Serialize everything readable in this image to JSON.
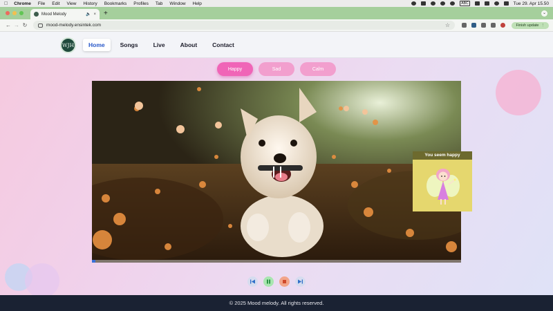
{
  "menubar": {
    "app": "Chrome",
    "items": [
      "File",
      "Edit",
      "View",
      "History",
      "Bookmarks",
      "Profiles",
      "Tab",
      "Window",
      "Help"
    ],
    "input_source": "ABC",
    "clock": "Tue 29. Apr  15.50"
  },
  "browser": {
    "tab_title": "Mood Melody",
    "url": "mood-melody.ensintek.com",
    "finish_update": "Finish update"
  },
  "site": {
    "logo_text": "WJH",
    "nav": [
      "Home",
      "Songs",
      "Live",
      "About",
      "Contact"
    ],
    "active_nav": "Home",
    "moods": [
      "Happy",
      "Sad",
      "Calm"
    ],
    "selected_mood": "Happy",
    "mood_card_title": "You seem happy",
    "video_progress": 0.01,
    "footer": "© 2025 Mood melody. All rights reserved."
  },
  "colors": {
    "accent": "#f065b7",
    "nav_active": "#2757c9",
    "footer_bg": "#1a2233"
  },
  "icons": {
    "controls": [
      "skip-previous-icon",
      "pause-icon",
      "stop-icon",
      "skip-next-icon"
    ]
  }
}
